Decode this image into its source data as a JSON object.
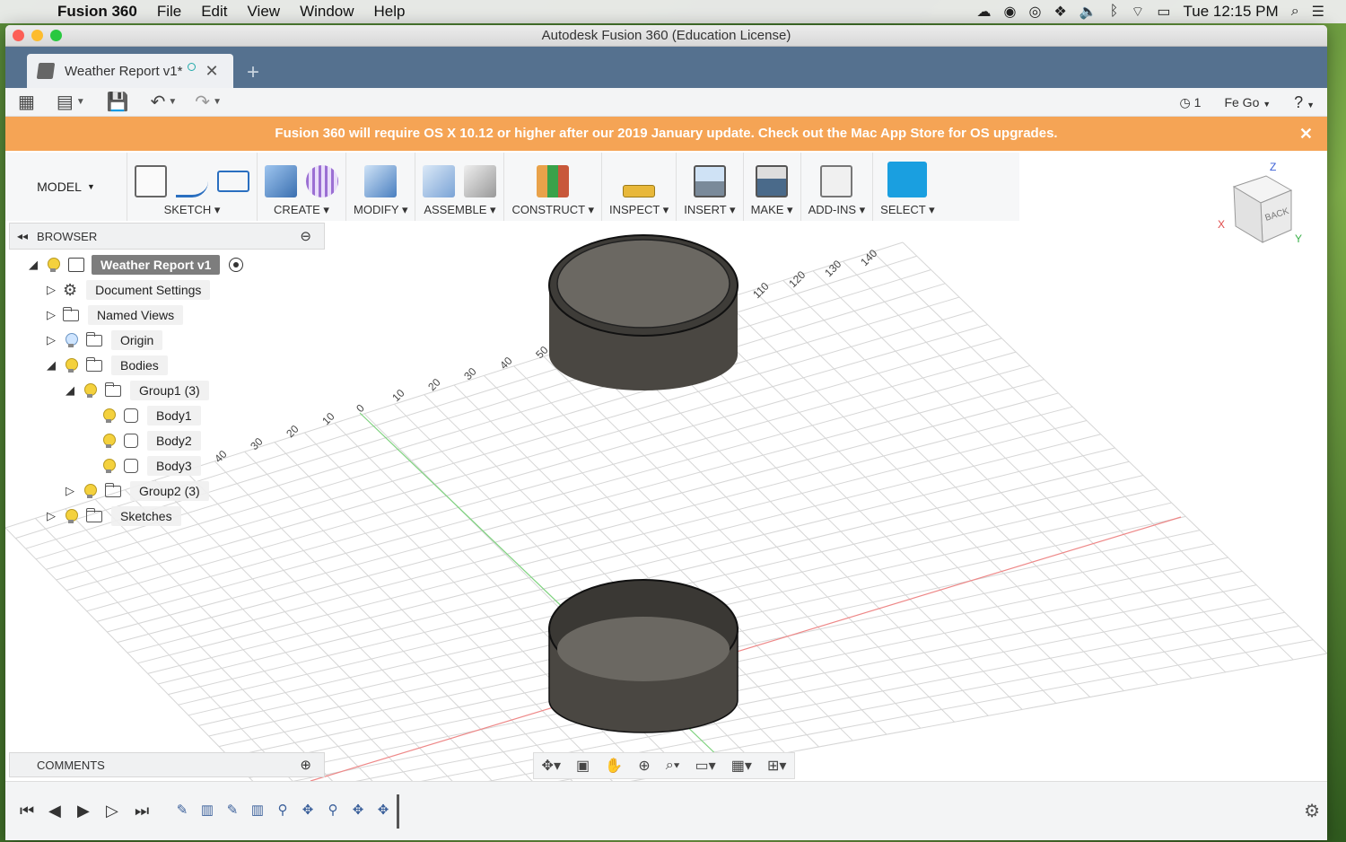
{
  "menubar": {
    "app_name": "Fusion 360",
    "items": [
      "File",
      "Edit",
      "View",
      "Window",
      "Help"
    ],
    "clock": "Tue 12:15 PM"
  },
  "window": {
    "title": "Autodesk Fusion 360 (Education License)"
  },
  "tab": {
    "document_title": "Weather Report v1*",
    "new_tab": "+"
  },
  "qat": {
    "jobs_count": "1",
    "user": "Fe Go"
  },
  "banner": {
    "message": "Fusion 360 will require OS X 10.12 or higher after our 2019 January update. Check out the Mac App Store for OS upgrades."
  },
  "toolbar": {
    "workspace": "MODEL",
    "groups": [
      "SKETCH",
      "CREATE",
      "MODIFY",
      "ASSEMBLE",
      "CONSTRUCT",
      "INSPECT",
      "INSERT",
      "MAKE",
      "ADD-INS",
      "SELECT"
    ]
  },
  "viewcube": {
    "face_label": "BACK",
    "axis_x": "X",
    "axis_y": "Y",
    "axis_z": "Z"
  },
  "browser": {
    "title": "BROWSER",
    "root": "Weather Report v1",
    "nodes": {
      "document_settings": "Document Settings",
      "named_views": "Named Views",
      "origin": "Origin",
      "bodies": "Bodies",
      "group1": "Group1 (3)",
      "body1": "Body1",
      "body2": "Body2",
      "body3": "Body3",
      "group2": "Group2 (3)",
      "sketches": "Sketches"
    }
  },
  "comments": {
    "title": "COMMENTS"
  },
  "grid_ticks": [
    "10",
    "20",
    "30",
    "40",
    "50",
    "110",
    "120",
    "130",
    "140",
    "10",
    "20",
    "30",
    "40",
    "0"
  ],
  "colors": {
    "banner": "#f5a455",
    "tabstrip": "#55718f",
    "select_active": "#1a9fe0",
    "body_fill": "#4a4742"
  }
}
